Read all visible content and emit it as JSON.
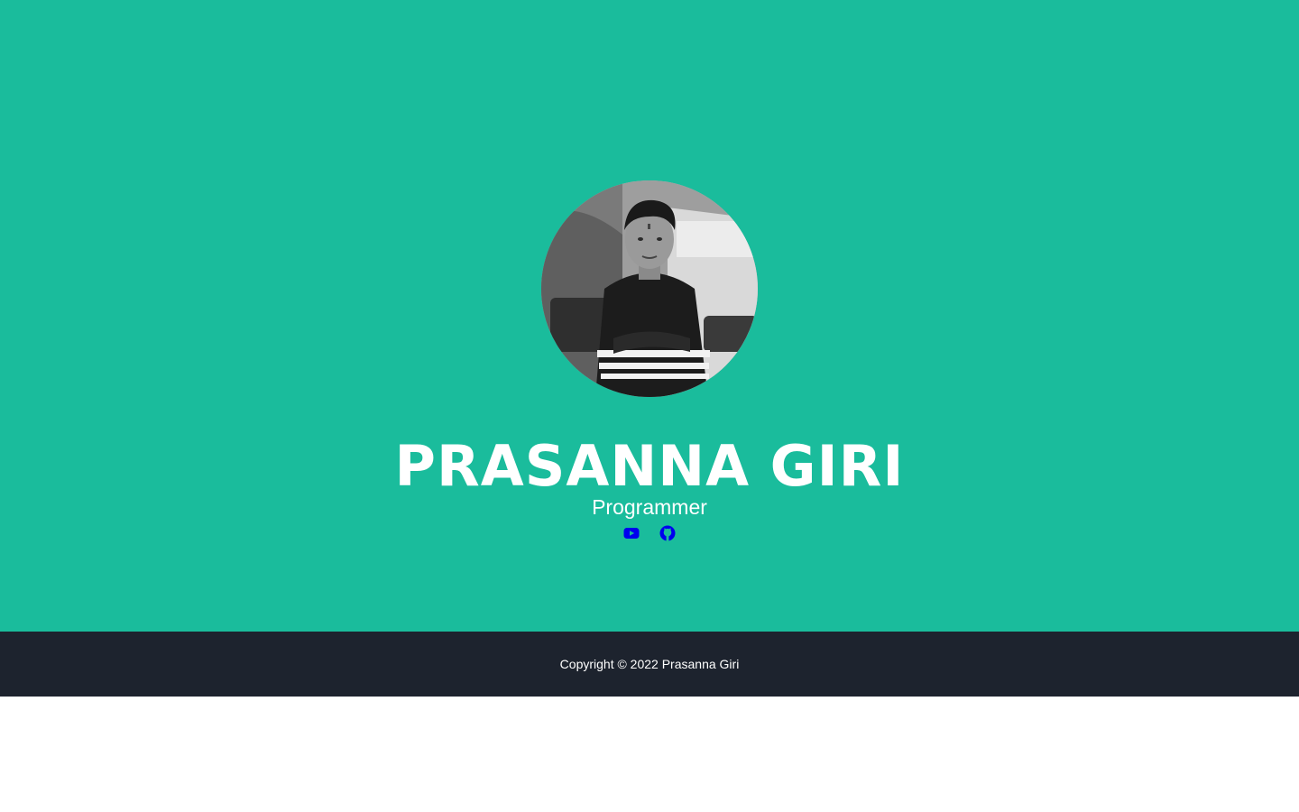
{
  "hero": {
    "background": "#1abc9c",
    "name": "PRASANNA GIRI",
    "subtitle": "Programmer",
    "avatar_alt": "Profile photo of Prasanna Giri"
  },
  "social": [
    {
      "name": "YouTube",
      "icon": "youtube-icon",
      "color": "#0000ee"
    },
    {
      "name": "GitHub",
      "icon": "github-icon",
      "color": "#0000ee"
    }
  ],
  "footer": {
    "background": "#1d232e",
    "copyright": "Copyright © 2022 Prasanna Giri"
  }
}
